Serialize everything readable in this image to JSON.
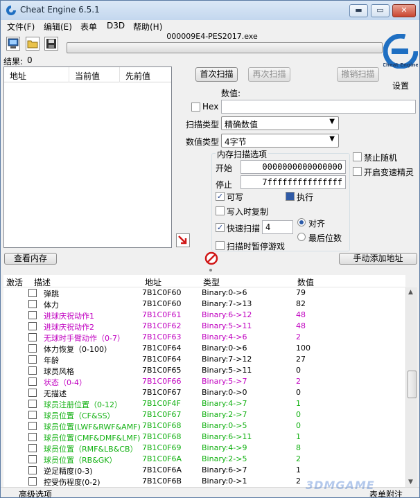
{
  "window": {
    "title": "Cheat Engine 6.5.1",
    "controls": {
      "minimize": "▬",
      "maximize": "▭",
      "close": "✕"
    }
  },
  "menu": [
    "文件(F)",
    "编辑(E)",
    "表单",
    "D3D",
    "帮助(H)"
  ],
  "process": {
    "name": "000009E4-PES2017.exe"
  },
  "settings_label": "设置",
  "results": {
    "label": "结果:",
    "count": "0"
  },
  "found_list": {
    "columns": [
      "地址",
      "当前值",
      "先前值"
    ]
  },
  "scan_buttons": {
    "first": "首次扫描",
    "next": "再次扫描",
    "undo": "撤销扫描"
  },
  "value": {
    "label": "数值:",
    "hex_label": "Hex",
    "input": ""
  },
  "scan_type": {
    "label": "扫描类型",
    "selected": "精确数值"
  },
  "value_type": {
    "label": "数值类型",
    "selected": "4字节"
  },
  "memory_options": {
    "title": "内存扫描选项",
    "start_label": "开始",
    "start_value": "0000000000000000",
    "stop_label": "停止",
    "stop_value": "7fffffffffffffff",
    "writable": "可写",
    "executable": "执行",
    "copy_on_write": "写入时复制",
    "fast_scan": "快速扫描",
    "fast_scan_value": "4",
    "align": "对齐",
    "last_digits": "最后位数",
    "pause_game": "扫描时暂停游戏"
  },
  "right_options": {
    "unrandomizer": "禁止随机",
    "speedhack": "开启变速精灵"
  },
  "view_memory": "查看内存",
  "add_address": "手动添加地址",
  "table": {
    "columns": [
      "激活",
      "描述",
      "地址",
      "类型",
      "数值"
    ],
    "rows": [
      {
        "desc": "弹跳",
        "addr": "7B1C0F60",
        "type": "Binary:0->6",
        "value": "79",
        "color": "#000000"
      },
      {
        "desc": "体力",
        "addr": "7B1C0F60",
        "type": "Binary:7->13",
        "value": "82",
        "color": "#000000"
      },
      {
        "desc": "进球庆祝动作1",
        "addr": "7B1C0F61",
        "type": "Binary:6->12",
        "value": "48",
        "color": "#c000c0"
      },
      {
        "desc": "进球庆祝动作2",
        "addr": "7B1C0F62",
        "type": "Binary:5->11",
        "value": "48",
        "color": "#c000c0"
      },
      {
        "desc": "无球时手臂动作（0-7）",
        "addr": "7B1C0F63",
        "type": "Binary:4->6",
        "value": "2",
        "color": "#c000c0"
      },
      {
        "desc": "体力恢复（0-100）",
        "addr": "7B1C0F64",
        "type": "Binary:0->6",
        "value": "100",
        "color": "#000000"
      },
      {
        "desc": "年龄",
        "addr": "7B1C0F64",
        "type": "Binary:7->12",
        "value": "27",
        "color": "#000000"
      },
      {
        "desc": "球员风格",
        "addr": "7B1C0F65",
        "type": "Binary:5->11",
        "value": "0",
        "color": "#000000"
      },
      {
        "desc": "状态（0-4）",
        "addr": "7B1C0F66",
        "type": "Binary:5->7",
        "value": "2",
        "color": "#c000c0"
      },
      {
        "desc": "无描述",
        "addr": "7B1C0F67",
        "type": "Binary:0->0",
        "value": "0",
        "color": "#000000"
      },
      {
        "desc": "球员注册位置（0-12）",
        "addr": "7B1C0F4F",
        "type": "Binary:4->7",
        "value": "1",
        "color": "#10b010"
      },
      {
        "desc": "球员位置（CF&SS）",
        "addr": "7B1C0F67",
        "type": "Binary:2->7",
        "value": "0",
        "color": "#10b010"
      },
      {
        "desc": "球员位置(LWF&RWF&AMF)",
        "addr": "7B1C0F68",
        "type": "Binary:0->5",
        "value": "0",
        "color": "#10b010"
      },
      {
        "desc": "球员位置(CMF&DMF&LMF)",
        "addr": "7B1C0F68",
        "type": "Binary:6->11",
        "value": "1",
        "color": "#10b010"
      },
      {
        "desc": "球员位置（RMF&LB&CB）",
        "addr": "7B1C0F69",
        "type": "Binary:4->9",
        "value": "8",
        "color": "#10b010"
      },
      {
        "desc": "球员位置（RB&GK）",
        "addr": "7B1C0F6A",
        "type": "Binary:2->5",
        "value": "2",
        "color": "#10b010"
      },
      {
        "desc": "逆足精度(0-3)",
        "addr": "7B1C0F6A",
        "type": "Binary:6->7",
        "value": "1",
        "color": "#000000"
      },
      {
        "desc": "控受伤程度(0-2)",
        "addr": "7B1C0F6B",
        "type": "Binary:0->1",
        "value": "2",
        "color": "#000000"
      }
    ]
  },
  "status": {
    "advanced": "高级选项",
    "extras": "表单附注"
  },
  "watermark": "3DMGAME"
}
